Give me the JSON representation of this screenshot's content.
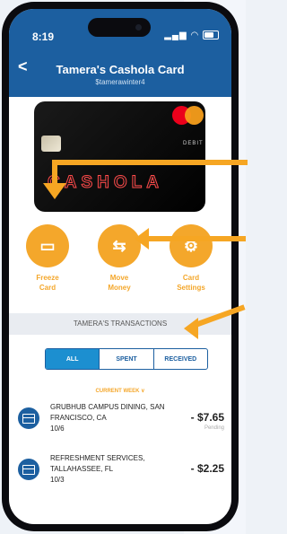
{
  "status": {
    "time": "8:19",
    "signal": "..ll",
    "wifi": "wifi"
  },
  "nav": {
    "back_label": "<",
    "title": "Tamera's Cashola Card",
    "subtitle": "$tamerawinter4"
  },
  "card": {
    "network": "mastercard",
    "type_label": "DEBIT",
    "brand_text": "CASHOLA"
  },
  "actions": [
    {
      "icon": "card-icon",
      "label_line1": "Freeze",
      "label_line2": "Card"
    },
    {
      "icon": "transfer-icon",
      "label_line1": "Move",
      "label_line2": "Money"
    },
    {
      "icon": "gear-icon",
      "label_line1": "Card",
      "label_line2": "Settings"
    }
  ],
  "transactions_header": "TAMERA'S TRANSACTIONS",
  "filter_tabs": [
    {
      "label": "ALL",
      "active": true
    },
    {
      "label": "SPENT",
      "active": false
    },
    {
      "label": "RECEIVED",
      "active": false
    }
  ],
  "period_label": "CURRENT WEEK ∨",
  "transactions": [
    {
      "line1": "GRUBHUB CAMPUS DINING, SAN",
      "line2": "FRANCISCO, CA",
      "date": "10/6",
      "amount": "- $7.65",
      "status": "Pending"
    },
    {
      "line1": "REFRESHMENT SERVICES,",
      "line2": "TALLAHASSEE, FL",
      "date": "10/3",
      "amount": "- $2.25",
      "status": ""
    }
  ],
  "colors": {
    "nav": "#1c5fa0",
    "accent": "#f4a72b",
    "arrow": "#f6a623"
  }
}
